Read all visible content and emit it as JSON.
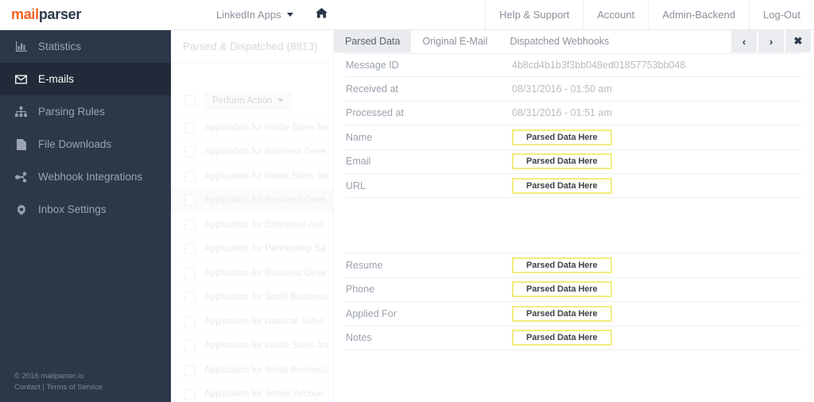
{
  "brand": {
    "part1": "mail",
    "part2": "parser",
    "orange": "#f26522",
    "navy": "#2c3749"
  },
  "topbar": {
    "app_switcher": {
      "label": "LinkedIn Apps",
      "icon": "chevron-down-icon"
    },
    "home_icon": "home-icon",
    "links": [
      {
        "label": "Help & Support"
      },
      {
        "label": "Account"
      },
      {
        "label": "Admin-Backend"
      },
      {
        "label": "Log-Out"
      }
    ]
  },
  "sidebar": {
    "items": [
      {
        "label": "Statistics",
        "icon": "bar-chart-icon",
        "active": false
      },
      {
        "label": "E-mails",
        "icon": "envelope-icon",
        "active": true
      },
      {
        "label": "Parsing Rules",
        "icon": "sitemap-icon",
        "active": false
      },
      {
        "label": "File Downloads",
        "icon": "file-icon",
        "active": false
      },
      {
        "label": "Webhook Integrations",
        "icon": "share-icon",
        "active": false
      },
      {
        "label": "Inbox Settings",
        "icon": "gear-icon",
        "active": false
      }
    ],
    "footer": {
      "copyright": "© 2016 mailparser.io",
      "contact": "Contact",
      "separator": " | ",
      "terms": "Terms of Service"
    }
  },
  "list": {
    "header": "Parsed & Dispatched (8813)",
    "action_button": "Perform Action",
    "rows": [
      {
        "subject": "Application for Inside Sales fro",
        "highlighted": false
      },
      {
        "subject": "Application for Business Deve",
        "highlighted": false
      },
      {
        "subject": "Application for Inside Sales fro",
        "highlighted": false
      },
      {
        "subject": "Application for Business Deve",
        "highlighted": true
      },
      {
        "subject": "Application for Enterprise Acc",
        "highlighted": false
      },
      {
        "subject": "Application for Partnership Sa",
        "highlighted": false
      },
      {
        "subject": "Application for Business Deve",
        "highlighted": false
      },
      {
        "subject": "Application for Small Business",
        "highlighted": false
      },
      {
        "subject": "Application for National Sales",
        "highlighted": false
      },
      {
        "subject": "Application for Inside Sales fro",
        "highlighted": false
      },
      {
        "subject": "Application for Small Business",
        "highlighted": false
      },
      {
        "subject": "Application for Senior Accoun",
        "highlighted": false
      }
    ]
  },
  "detail": {
    "tabs": [
      {
        "label": "Parsed Data",
        "active": true
      },
      {
        "label": "Original E-Mail",
        "active": false
      },
      {
        "label": "Dispatched Webhooks",
        "active": false
      }
    ],
    "nav_buttons": [
      {
        "glyph": "‹",
        "icon": "chevron-left-icon"
      },
      {
        "glyph": "›",
        "icon": "chevron-right-icon"
      },
      {
        "glyph": "✖",
        "icon": "close-icon"
      }
    ],
    "parsed_placeholder": "Parsed Data Here",
    "highlight_color": "#f2ec7e",
    "rows": [
      {
        "label": "Message ID",
        "value": "4b8cd4b1b3f3bb048ed01857753bb048",
        "parsed": false
      },
      {
        "label": "Received at",
        "value": "08/31/2016 - 01:50 am",
        "parsed": false
      },
      {
        "label": "Processed at",
        "value": "08/31/2016 - 01:51 am",
        "parsed": false
      },
      {
        "label": "Name",
        "value": "Parsed Data Here",
        "parsed": true
      },
      {
        "label": "Email",
        "value": "Parsed Data Here",
        "parsed": true
      },
      {
        "label": "URL",
        "value": "Parsed Data Here",
        "parsed": true
      },
      {
        "label": "",
        "value": "",
        "parsed": false,
        "spacer": true
      },
      {
        "label": "Resume",
        "value": "Parsed Data Here",
        "parsed": true
      },
      {
        "label": "Phone",
        "value": "Parsed Data Here",
        "parsed": true
      },
      {
        "label": "Applied For",
        "value": "Parsed Data Here",
        "parsed": true
      },
      {
        "label": "Notes",
        "value": "Parsed Data Here",
        "parsed": true
      }
    ]
  }
}
